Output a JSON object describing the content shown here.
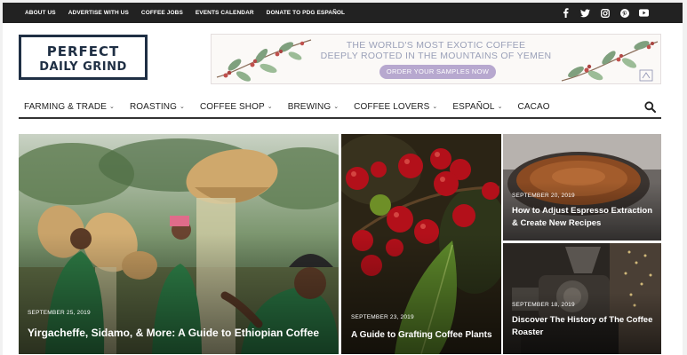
{
  "topbar": {
    "links": [
      "ABOUT US",
      "ADVERTISE WITH US",
      "COFFEE JOBS",
      "EVENTS CALENDAR",
      "DONATE TO PDG ESPAÑOL"
    ],
    "social_icons": [
      "facebook-icon",
      "twitter-icon",
      "instagram-icon",
      "pinterest-icon",
      "youtube-icon"
    ]
  },
  "logo": {
    "line1": "PERFECT",
    "line2": "DAILY GRIND"
  },
  "ad": {
    "headline1": "THE WORLD'S MOST EXOTIC COFFEE",
    "headline2": "DEEPLY ROOTED IN THE MOUNTAINS OF YEMEN",
    "button": "ORDER YOUR SAMPLES NOW",
    "accent_color": "#b7a8cf",
    "text_color": "#9aa0b8"
  },
  "nav": {
    "items": [
      {
        "label": "FARMING & TRADE",
        "has_dropdown": true
      },
      {
        "label": "ROASTING",
        "has_dropdown": true
      },
      {
        "label": "COFFEE SHOP",
        "has_dropdown": true
      },
      {
        "label": "BREWING",
        "has_dropdown": true
      },
      {
        "label": "COFFEE LOVERS",
        "has_dropdown": true
      },
      {
        "label": "ESPAÑOL",
        "has_dropdown": true
      },
      {
        "label": "CACAO",
        "has_dropdown": false
      }
    ],
    "search_icon": "search-icon"
  },
  "articles": [
    {
      "date": "SEPTEMBER 25, 2019",
      "title": "Yirgacheffe, Sidamo, & More: A Guide to Ethiopian Coffee"
    },
    {
      "date": "SEPTEMBER 23, 2019",
      "title": "A Guide to Grafting Coffee Plants"
    },
    {
      "date": "SEPTEMBER 20, 2019",
      "title": "How to Adjust Espresso Extraction & Create New Recipes"
    },
    {
      "date": "SEPTEMBER 18, 2019",
      "title": "Discover The History of The Coffee Roaster"
    }
  ]
}
